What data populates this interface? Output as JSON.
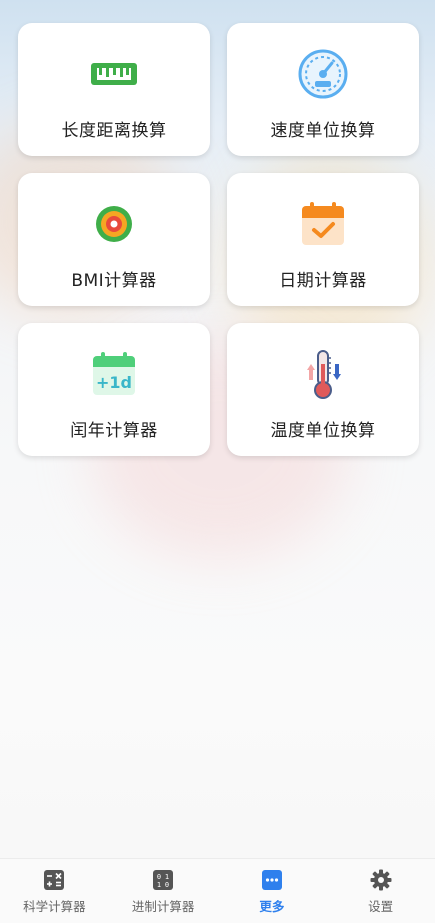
{
  "cards": [
    {
      "label": "长度距离换算",
      "icon": "ruler-icon"
    },
    {
      "label": "速度单位换算",
      "icon": "speedometer-icon"
    },
    {
      "label": "BMI计算器",
      "icon": "target-icon"
    },
    {
      "label": "日期计算器",
      "icon": "calendar-check-icon"
    },
    {
      "label": "闰年计算器",
      "icon": "calendar-plus-1d-icon"
    },
    {
      "label": "温度单位换算",
      "icon": "thermometer-icon"
    }
  ],
  "calendar_badge_text": "+1d",
  "tabs": [
    {
      "label": "科学计算器",
      "icon": "calculator-icon",
      "active": false
    },
    {
      "label": "进制计算器",
      "icon": "binary-icon",
      "active": false
    },
    {
      "label": "更多",
      "icon": "more-icon",
      "active": true
    },
    {
      "label": "设置",
      "icon": "gear-icon",
      "active": false
    }
  ],
  "colors": {
    "accent": "#2f80ed",
    "ruler_green": "#3fae49",
    "speed_blue": "#5aaef0",
    "calendar_orange": "#f58a1f",
    "calendar_green": "#4fcf7a",
    "thermo_red": "#e05a5a"
  }
}
